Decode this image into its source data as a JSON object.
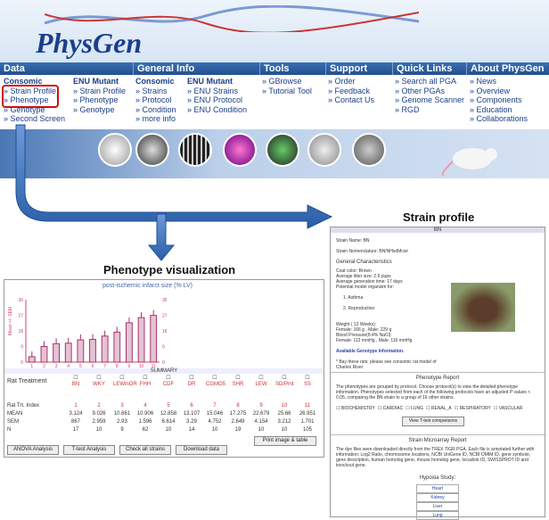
{
  "logo": "PhysGen",
  "nav": [
    "Data",
    "General Info",
    "Tools",
    "Support",
    "Quick Links",
    "About PhysGen"
  ],
  "submenu": {
    "data_consomic": [
      "Consomic",
      "» Strain Profile",
      "» Phenotype",
      "» Genotype",
      "» Second Screen"
    ],
    "data_enu": [
      "ENU Mutant",
      "» Strain Profile",
      "» Phenotype",
      "» Genotype"
    ],
    "gi_consomic": [
      "Consomic",
      "» Strains",
      "» Protocol",
      "» Condition",
      "» more info"
    ],
    "gi_enu": [
      "ENU Mutant",
      "» ENU Strains",
      "» ENU Protocol",
      "» ENU Condition"
    ],
    "tools": [
      "» GBrowse",
      "» Tutorial Tool"
    ],
    "support": [
      "» Order",
      "» Feedback",
      "» Contact Us"
    ],
    "quick": [
      "» Search all PGA",
      "» Other PGAs",
      "» Genome Scanner",
      "» RGD"
    ],
    "about": [
      "» News",
      "» Overview",
      "» Components",
      "» Education",
      "» Collaborations"
    ]
  },
  "labels": {
    "strain_profile": "Strain profile",
    "phenotype_vis": "Phenotype visualization"
  },
  "pheno": {
    "title": "post-ischemic infarct size (% LV)",
    "summary": "SUMMARY",
    "row_treatment": "Rat Treatment",
    "row_index": "Rat Trt. Index",
    "row_mean": "MEAN",
    "row_sem": "SEM",
    "row_n": "N",
    "strains": [
      "BN",
      "WKY",
      "LEWinOR",
      "FHH",
      "CDF",
      "DR",
      "CGMO5",
      "SHR",
      "LEW",
      "SD/Pmt",
      "SS"
    ],
    "index": [
      "1",
      "2",
      "3",
      "4",
      "5",
      "6",
      "7",
      "8",
      "9",
      "10",
      "11"
    ],
    "mean": [
      "3.124",
      "9.026",
      "10.661",
      "10.906",
      "12.858",
      "13.107",
      "15.046",
      "17.275",
      "22.679",
      "25.66",
      "26.951"
    ],
    "sem": [
      "867",
      "2.959",
      "2.93",
      "1.596",
      "6.614",
      "3.29",
      "4.752",
      "2.649",
      "4.154",
      "3.212",
      "1.701"
    ],
    "n": [
      "17",
      "10",
      "9",
      "62",
      "10",
      "14",
      "10",
      "19",
      "10",
      "10",
      "105"
    ],
    "buttons": [
      "ANOVA Analysis",
      "T-test Analysis",
      "Check all strains",
      "Download data"
    ],
    "print": "Print image & table",
    "chart_data": {
      "type": "bar",
      "categories": [
        "1",
        "2",
        "3",
        "4",
        "5",
        "6",
        "7",
        "8",
        "9",
        "10",
        "11"
      ],
      "values": [
        3.124,
        9.026,
        10.661,
        10.906,
        12.858,
        13.107,
        15.046,
        17.275,
        22.679,
        25.66,
        26.951
      ],
      "ylim": [
        0,
        36
      ],
      "ylabel": "Mean +/- SEM"
    }
  },
  "strain": {
    "head": "BN",
    "name": "Strain Name: BN",
    "nomen": "Strain Nomenclature: BN/NHsdMcwi",
    "general": "General Characteristics",
    "details": [
      "Coat color: Brown",
      "Average litter size: 2.6 pups",
      "Average generation time: 17 days",
      "Potential model organism for:"
    ],
    "models": [
      "1. Asthma",
      "2. Reproduction"
    ],
    "weight": [
      "Weight ( 12 Weeks):",
      "Female: 166 g , Male: 229 g",
      "Blood Pressure(8.4% NaCl):",
      "Female: 112 mmHg , Male: 116 mmHg"
    ],
    "geno": "Available Genotype Information.",
    "note": "* Bay these rats: please see consomic rat model of Charles River",
    "pheno_head": "Phenotype Report",
    "pheno_text": "The phenotypes are grouped by protocol. Choose protocol(s) to view the detailed phenotype information. Phenotypes selected from each of the following protocols have an adjusted P values < 0.05, comparing the BN strain to a group of 16 other strains.",
    "checks": [
      "BIOCHEMISTRY",
      "CARDIAC",
      "LUNG",
      "RENAL_A",
      "RESPIRATORY",
      "VASCULAR"
    ],
    "view_btn": "View T-test comparisons",
    "micro_head": "Strain Microarray Report",
    "micro_text": "The dye files were downloaded directly from the TREX TIGR PGA. Each file is annotated further with information: Log2 Ratio, chromosome locations, NCBI UniGene ID, NCBI OMIM ID, gene symbole, gene description, human homolog gene, mouse homolog gene, locuslink ID, SWISSPROT ID and knockout gene.",
    "hypoxia": "Hypoxia Study:",
    "organs": [
      "Heart",
      "Kidney",
      "Liver",
      "Lung"
    ]
  }
}
